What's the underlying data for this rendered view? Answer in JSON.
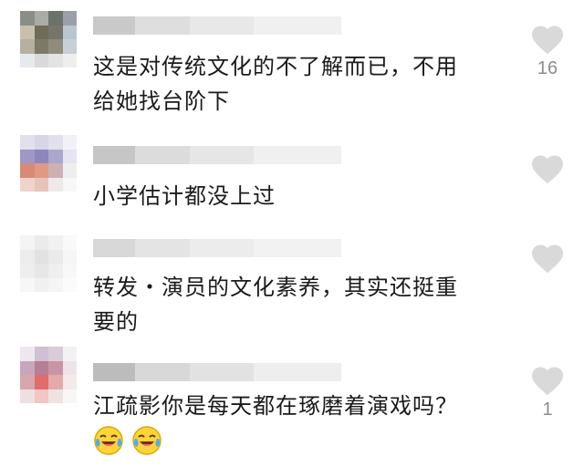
{
  "comments": [
    {
      "text": "这是对传统文化的不了解而已，不用\n给她找台阶下",
      "likes": "16",
      "avatar_colors": [
        "#8a8f86",
        "#a9aca6",
        "#6d7268",
        "#9aa0a7",
        "#c8c0ab",
        "#6f6d58",
        "#77756a",
        "#b7c6cf",
        "#b6b19f",
        "#7c7966",
        "#8f8c7d",
        "#c9cfd6",
        "#e6e9ee",
        "#d8d9d8",
        "#e3e3e3",
        "#eeeeee"
      ],
      "username_colors": [
        "#c9c9c9",
        "#dedede",
        "#e8e8e8",
        "#f0f0f0"
      ]
    },
    {
      "text": "小学估计都没上过",
      "likes": "",
      "avatar_colors": [
        "#e3e0ee",
        "#d7d5e6",
        "#e1e0ec",
        "#f1f1f7",
        "#9d98c6",
        "#8d86bc",
        "#aba6cc",
        "#e6e4f1",
        "#d88a76",
        "#e09a84",
        "#cdb0b3",
        "#eeeeee",
        "#f0d3cb",
        "#e8c3b9",
        "#efe9ea",
        "#f7f7f7"
      ],
      "username_colors": [
        "#c6c6c6",
        "#dcdcdc",
        "#e6e6e6",
        "#f0f0f0"
      ]
    },
    {
      "text": "转发・演员的文化素养，其实还挺重\n要的",
      "likes": "",
      "avatar_colors": [
        "#f4f4f4",
        "#ebebeb",
        "#f1f1f1",
        "#f9f9f9",
        "#ececec",
        "#e2e2e2",
        "#eaeaea",
        "#f6f6f6",
        "#eeeeee",
        "#e7e7e7",
        "#efefef",
        "#f8f8f8",
        "#f7f7f7",
        "#f0f0f0",
        "#f5f5f5",
        "#fbfbfb"
      ],
      "username_colors": [
        "#d8d8d8",
        "#e4e4e4",
        "#ececec",
        "#f2f2f2"
      ]
    },
    {
      "text": "江疏影你是每天都在琢磨着演戏吗？",
      "likes": "1",
      "avatar_colors": [
        "#ede8f0",
        "#cfc0d4",
        "#d9cbd8",
        "#f4f1f4",
        "#c7a6bd",
        "#b57f96",
        "#c995a6",
        "#eee3e8",
        "#d8a6ad",
        "#e06c6c",
        "#e4a9ab",
        "#f4eaea",
        "#eee0e2",
        "#f1c6c3",
        "#f1e2e2",
        "#f9f6f6"
      ],
      "username_colors": [
        "#bcbcbc",
        "#d8d8d8",
        "#e2e2e2",
        "#eeeeee"
      ],
      "emoji": [
        "laughing-crying",
        "laughing-crying"
      ]
    }
  ],
  "heart_color": "#d9d9d9"
}
